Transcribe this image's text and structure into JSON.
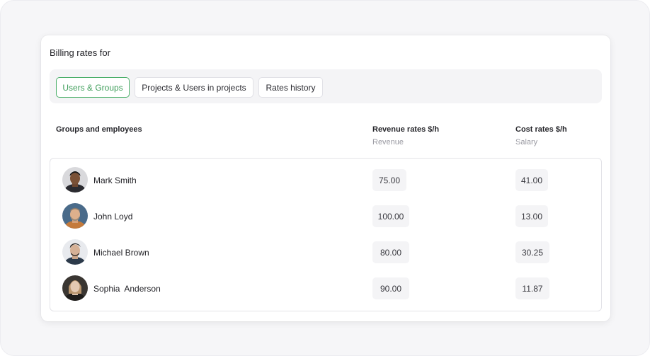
{
  "card": {
    "title": "Billing rates for"
  },
  "tabs": [
    {
      "label": "Users & Groups",
      "active": true
    },
    {
      "label": "Projects & Users in projects",
      "active": false
    },
    {
      "label": "Rates history",
      "active": false
    }
  ],
  "columns": {
    "groups": "Groups and employees",
    "revenue": "Revenue rates $/h",
    "revenue_sub": "Revenue",
    "cost": "Cost rates $/h",
    "cost_sub": "Salary"
  },
  "rows": [
    {
      "name": "Mark Smith",
      "revenue": "75.00",
      "cost": "41.00"
    },
    {
      "name": "John Loyd",
      "revenue": "100.00",
      "cost": "13.00"
    },
    {
      "name": "Michael Brown",
      "revenue": "80.00",
      "cost": "30.25"
    },
    {
      "name": "Sophia  Anderson",
      "revenue": "90.00",
      "cost": "11.87"
    }
  ],
  "colors": {
    "accent": "#3f9e5b",
    "pill_bg": "#f4f4f6"
  }
}
